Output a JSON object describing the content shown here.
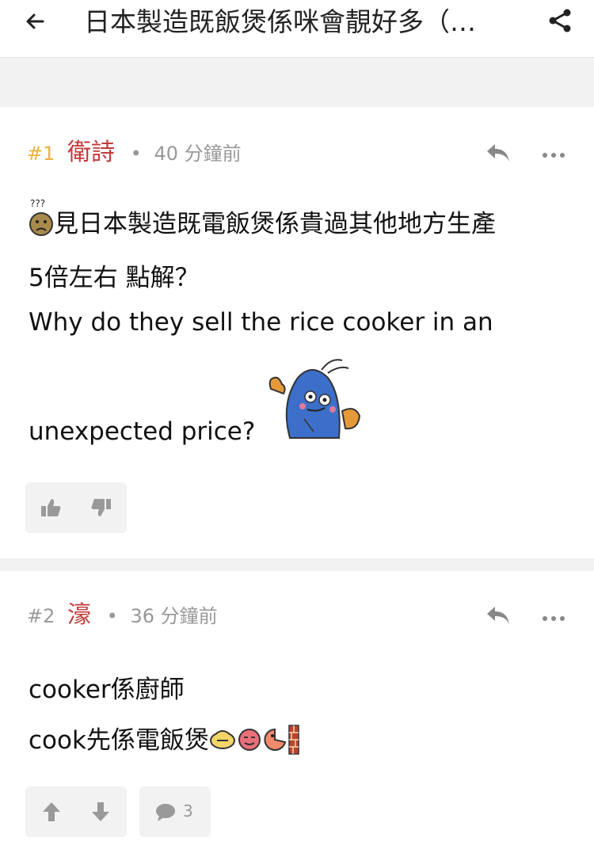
{
  "header": {
    "title": "日本製造既飯煲係咪會靚好多（…",
    "back_icon": "arrow-left-icon",
    "share_icon": "share-icon"
  },
  "posts": [
    {
      "number": "#1",
      "username": "衛詩",
      "time": "40 分鐘前",
      "lines": [
        "見日本製造既電飯煲係貴過其他地方生產",
        "5倍左右 點解？",
        "Why do they sell the rice cooker in an",
        "unexpected price?"
      ],
      "emoticons": [
        "confused-face-emoji",
        "blue-monster-sticker"
      ],
      "actions": [
        "thumbs-up-icon",
        "thumbs-down-icon"
      ]
    },
    {
      "number": "#2",
      "username": "濠",
      "time": "36 分鐘前",
      "lines": [
        "cooker係廚師",
        "cook先係電飯煲"
      ],
      "emoticons": [
        "shy-face-emoji",
        "red-face-emoji",
        "pacman-face-emoji",
        "brick-wall-emoji"
      ],
      "actions": [
        "upvote-arrow-icon",
        "downvote-arrow-icon"
      ],
      "comment_count": "3"
    }
  ],
  "colors": {
    "accent_number": "#e8b43a",
    "username": "#c23a3a",
    "meta": "#999999"
  }
}
